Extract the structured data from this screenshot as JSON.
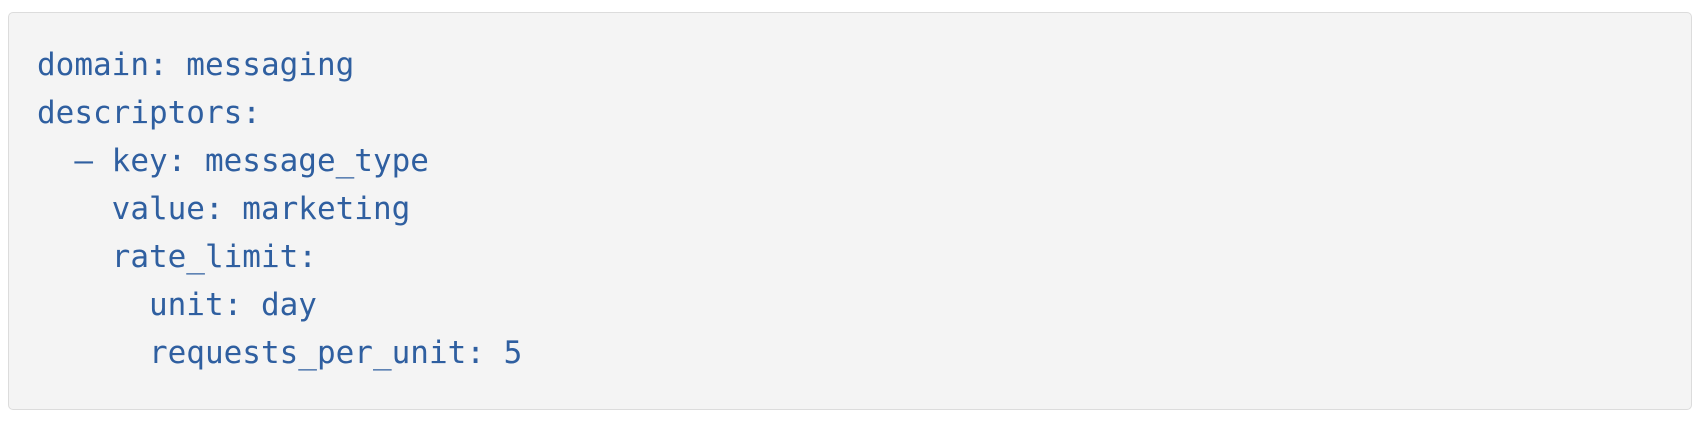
{
  "code_block": {
    "lines": [
      {
        "indent": "",
        "text": "domain: messaging"
      },
      {
        "indent": "",
        "text": "descriptors:"
      },
      {
        "indent": "  ",
        "text": "– key: message_type"
      },
      {
        "indent": "    ",
        "text": "value: marketing"
      },
      {
        "indent": "    ",
        "text": "rate_limit:"
      },
      {
        "indent": "      ",
        "text": "unit: day"
      },
      {
        "indent": "      ",
        "text": "requests_per_unit: 5"
      }
    ]
  },
  "colors": {
    "code_text": "#2f5fa0",
    "block_background": "#f4f4f4",
    "block_border": "#dcdcdc"
  }
}
